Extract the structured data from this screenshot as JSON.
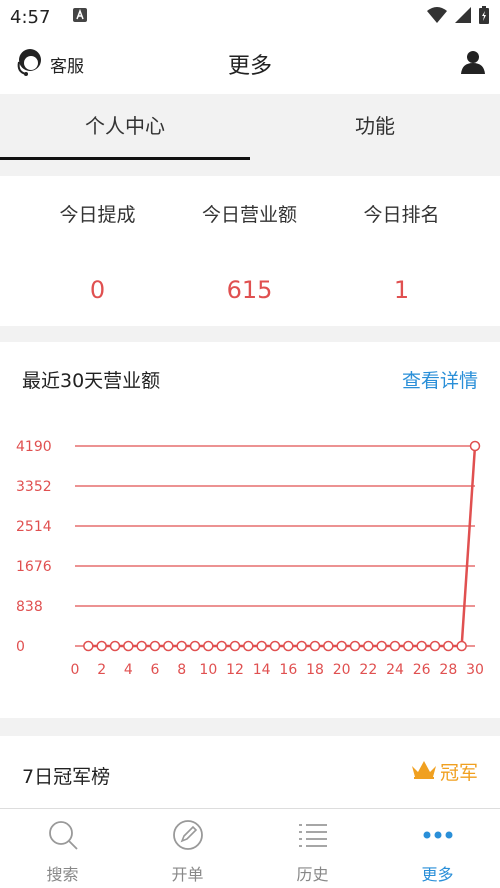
{
  "status": {
    "time": "4:57"
  },
  "appbar": {
    "service_label": "客服",
    "title": "更多"
  },
  "tabs": [
    {
      "label": "个人中心",
      "active": true
    },
    {
      "label": "功能",
      "active": false
    }
  ],
  "stats": [
    {
      "label": "今日提成",
      "value": "0"
    },
    {
      "label": "今日营业额",
      "value": "615"
    },
    {
      "label": "今日排名",
      "value": "1"
    }
  ],
  "chart_section": {
    "title": "最近30天营业额",
    "detail_link": "查看详情"
  },
  "chart_data": {
    "type": "line",
    "title": "",
    "xlabel": "",
    "ylabel": "",
    "x": [
      1,
      2,
      3,
      4,
      5,
      6,
      7,
      8,
      9,
      10,
      11,
      12,
      13,
      14,
      15,
      16,
      17,
      18,
      19,
      20,
      21,
      22,
      23,
      24,
      25,
      26,
      27,
      28,
      29,
      30
    ],
    "series": [
      {
        "values": [
          0,
          0,
          0,
          0,
          0,
          0,
          0,
          0,
          0,
          0,
          0,
          0,
          0,
          0,
          0,
          0,
          0,
          0,
          0,
          0,
          0,
          0,
          0,
          0,
          0,
          0,
          0,
          0,
          0,
          4190
        ]
      }
    ],
    "xticks": [
      "0",
      "2",
      "4",
      "6",
      "8",
      "10",
      "12",
      "14",
      "16",
      "18",
      "20",
      "22",
      "24",
      "26",
      "28",
      "30"
    ],
    "yticks": [
      "0",
      "838",
      "1676",
      "2514",
      "3352",
      "4190"
    ],
    "xlim": [
      0,
      30
    ],
    "ylim": [
      0,
      4190
    ],
    "grid": true,
    "color": "#e05050"
  },
  "champion": {
    "title": "7日冠军榜",
    "badge_label": "冠军"
  },
  "nav": [
    {
      "label": "搜索",
      "icon": "search-icon",
      "active": false
    },
    {
      "label": "开单",
      "icon": "pen-icon",
      "active": false
    },
    {
      "label": "历史",
      "icon": "list-icon",
      "active": false
    },
    {
      "label": "更多",
      "icon": "more-icon",
      "active": true
    }
  ],
  "colors": {
    "accent": "#2a8fd8",
    "chart": "#e05050",
    "badge": "#f0a020"
  }
}
